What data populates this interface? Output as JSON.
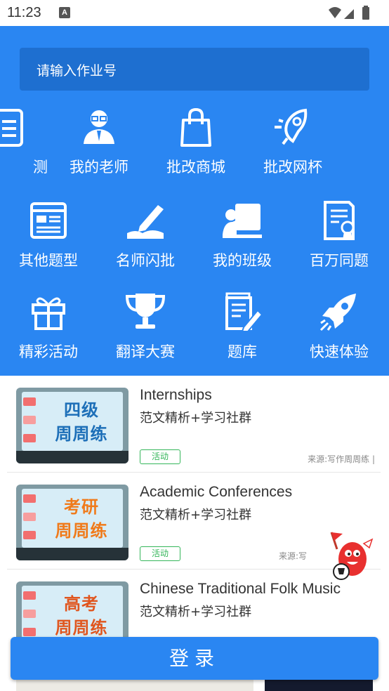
{
  "status_bar": {
    "time": "11:23",
    "notification_glyph": "A"
  },
  "search": {
    "placeholder": "请输入作业号"
  },
  "grid": {
    "row1": [
      "测",
      "我的老师",
      "批改商城",
      "批改网杯"
    ],
    "row2": [
      "其他题型",
      "名师闪批",
      "我的班级",
      "百万同题"
    ],
    "row3": [
      "精彩活动",
      "翻译大赛",
      "题库",
      "快速体验"
    ]
  },
  "cards": [
    {
      "title": "Internships",
      "subtitle": "范文精析+学习社群",
      "tag": "活动",
      "source": "来源:写作周周练 |",
      "thumb_line1": "四级",
      "thumb_line2": "周周练",
      "thumb_color": "#1d6fb8"
    },
    {
      "title": "Academic Conferences",
      "subtitle": "范文精析+学习社群",
      "tag": "活动",
      "source": "来源:写",
      "thumb_line1": "考研",
      "thumb_line2": "周周练",
      "thumb_color": "#f07a1a"
    },
    {
      "title": "Chinese Traditional Folk Music",
      "subtitle": "范文精析+学习社群",
      "thumb_line1": "高考",
      "thumb_line2": "周周练",
      "thumb_color": "#e0561f"
    }
  ],
  "login_button": {
    "label": "登录"
  },
  "colors": {
    "primary": "#2a86f2",
    "search_bg": "#1e6fd0",
    "tag_green": "#35b65a"
  }
}
